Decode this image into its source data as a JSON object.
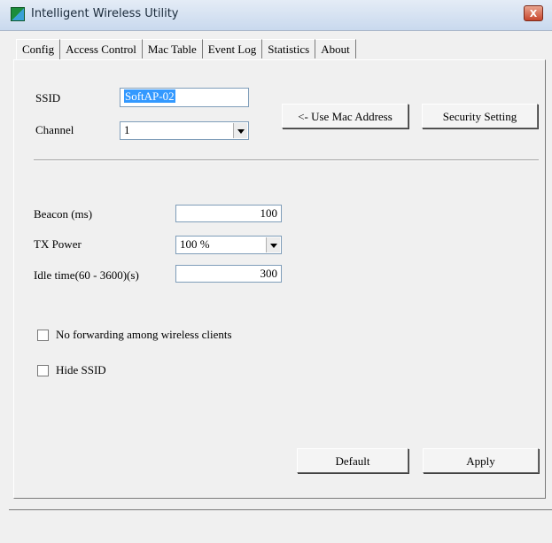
{
  "window": {
    "title": "Intelligent Wireless Utility",
    "close_label": "X"
  },
  "tabs": [
    {
      "label": "Config",
      "active": true
    },
    {
      "label": "Access Control",
      "active": false
    },
    {
      "label": "Mac Table",
      "active": false
    },
    {
      "label": "Event Log",
      "active": false
    },
    {
      "label": "Statistics",
      "active": false
    },
    {
      "label": "About",
      "active": false
    }
  ],
  "config": {
    "ssid_label": "SSID",
    "ssid_value": "SoftAP-02",
    "channel_label": "Channel",
    "channel_value": "1",
    "use_mac_button": "<- Use Mac Address",
    "security_button": "Security Setting",
    "beacon_label": "Beacon (ms)",
    "beacon_value": "100",
    "tx_power_label": "TX Power",
    "tx_power_value": "100 %",
    "idle_label": "Idle time(60 - 3600)(s)",
    "idle_value": "300",
    "no_forwarding_label": "No forwarding among wireless clients",
    "no_forwarding_checked": false,
    "hide_ssid_label": "Hide SSID",
    "hide_ssid_checked": false,
    "default_button": "Default",
    "apply_button": "Apply"
  },
  "icons": {
    "app": "wireless-utility-icon",
    "close": "close-icon",
    "dropdown": "chevron-down-icon"
  }
}
